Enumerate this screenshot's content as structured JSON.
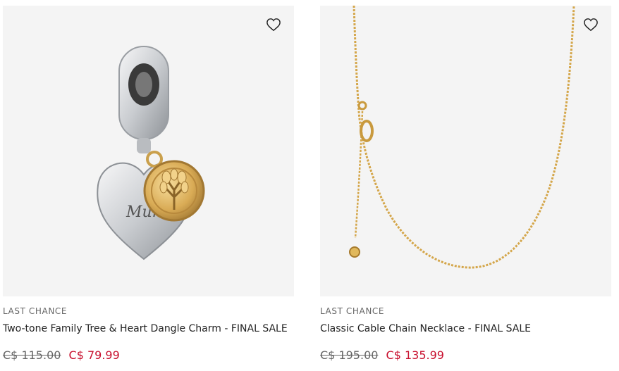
{
  "products": [
    {
      "badge": "LAST CHANCE",
      "name": "Two-tone Family Tree & Heart Dangle Charm - FINAL SALE",
      "old_price": "C$ 115.00",
      "new_price": "C$ 79.99",
      "engraving": "Mum",
      "icon": "heart-outline-icon"
    },
    {
      "badge": "LAST CHANCE",
      "name": "Classic Cable Chain Necklace - FINAL SALE",
      "old_price": "C$ 195.00",
      "new_price": "C$ 135.99",
      "icon": "heart-outline-icon"
    }
  ],
  "colors": {
    "sale_price": "#c8102e",
    "gold": "#d4a64a",
    "silver": "#cfd2d6",
    "image_bg": "#f4f4f4"
  }
}
